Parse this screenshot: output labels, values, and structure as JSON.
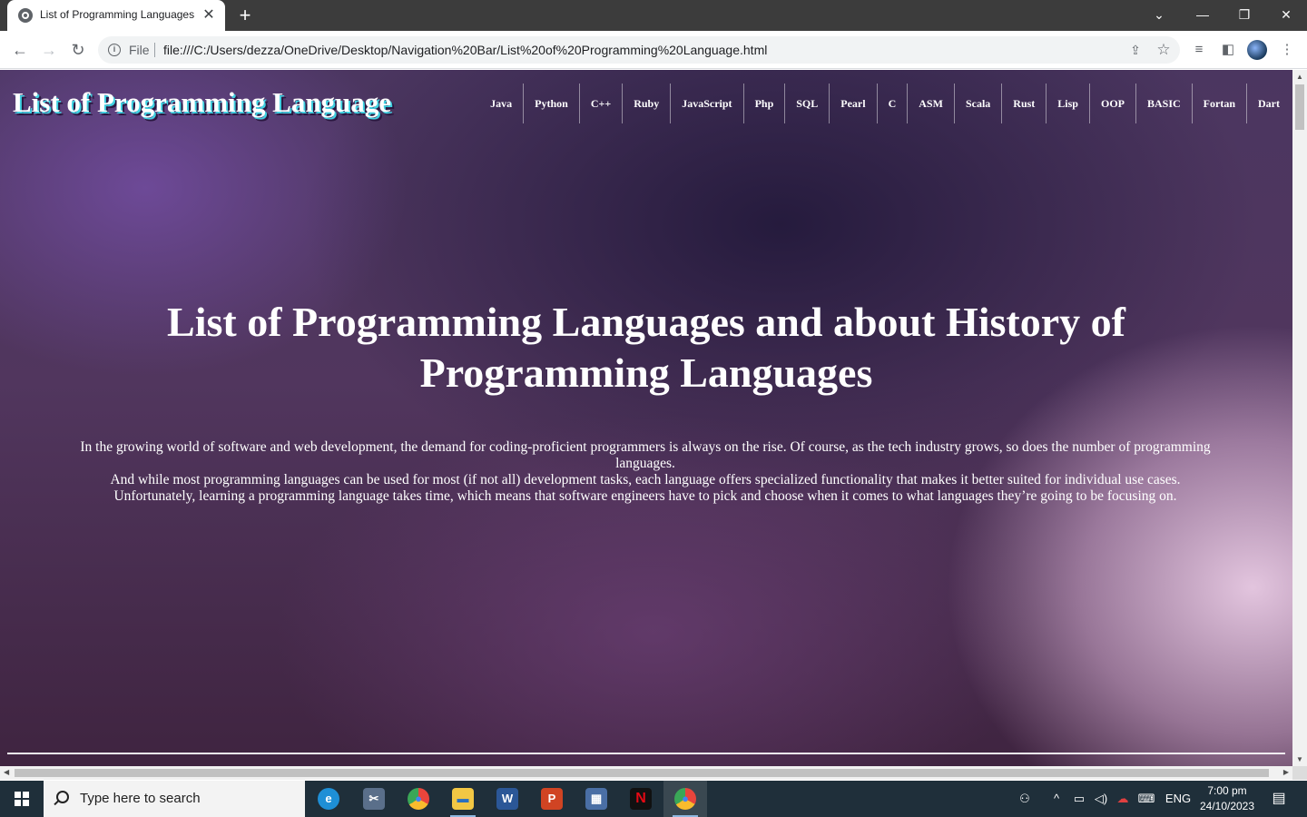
{
  "browser": {
    "tab_title": "List of Programming Languages",
    "tab_close": "✕",
    "new_tab": "+",
    "window_controls": {
      "collapse": "⌄",
      "minimize": "—",
      "restore": "❐",
      "close": "✕"
    },
    "nav": {
      "back": "←",
      "forward": "→",
      "reload": "↻"
    },
    "scheme_label": "File",
    "url": "file:///C:/Users/dezza/OneDrive/Desktop/Navigation%20Bar/List%20of%20Programming%20Language.html"
  },
  "page": {
    "site_title": "List of Programming Language",
    "nav_items": [
      "Java",
      "Python",
      "C++",
      "Ruby",
      "JavaScript",
      "Php",
      "SQL",
      "Pearl",
      "C",
      "ASM",
      "Scala",
      "Rust",
      "Lisp",
      "OOP",
      "BASIC",
      "Fortan",
      "Dart"
    ],
    "headline": "List of Programming Languages and about History of Programming Languages",
    "intro_1": "In the growing world of software and web development, the demand for coding-proficient programmers is always on the rise. Of course, as the tech industry grows, so does the number of programming languages.",
    "intro_2": "And while most programming languages can be used for most (if not all) development tasks, each language offers specialized functionality that makes it better suited for individual use cases.",
    "intro_3": "Unfortunately, learning a programming language takes time, which means that software engineers have to pick and choose when it comes to what languages they’re going to be focusing on."
  },
  "taskbar": {
    "search_placeholder": "Type here to search",
    "apps": [
      {
        "name": "edge",
        "glyph": "e",
        "color": "#1e8fd6"
      },
      {
        "name": "snip",
        "glyph": "✂",
        "color": "#5a6f8a"
      },
      {
        "name": "chrome",
        "glyph": "●",
        "color": "#e8453c"
      },
      {
        "name": "file-explorer",
        "glyph": "▬",
        "color": "#f2c744"
      },
      {
        "name": "word",
        "glyph": "W",
        "color": "#2b5797"
      },
      {
        "name": "powerpoint",
        "glyph": "P",
        "color": "#d04423"
      },
      {
        "name": "teams-like",
        "glyph": "▦",
        "color": "#4a6fa5"
      },
      {
        "name": "netflix",
        "glyph": "N",
        "color": "#111111"
      },
      {
        "name": "chrome-active",
        "glyph": "●",
        "color": "#e8453c"
      }
    ],
    "language": "ENG",
    "time": "7:00 pm",
    "date": "24/10/2023"
  }
}
